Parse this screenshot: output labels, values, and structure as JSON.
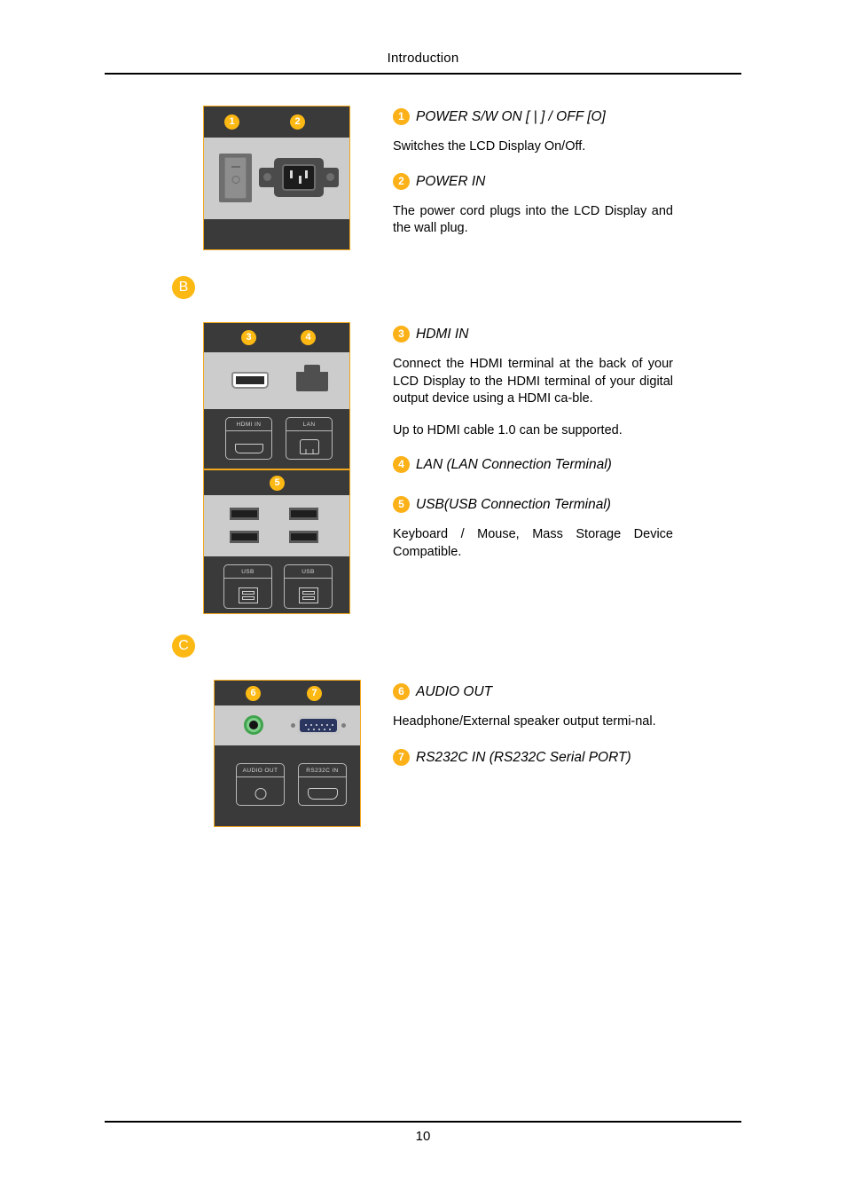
{
  "header": {
    "title": "Introduction"
  },
  "footer": {
    "page_number": "10"
  },
  "colors": {
    "badge_orange": "#fbb117",
    "panel_border_orange": "#f0a81e",
    "panel_dark": "#3a3a3a",
    "panel_light": "#cccccc",
    "audio_jack_green": "#3fa34d"
  },
  "sections": {
    "b_letter": "B",
    "c_letter": "C"
  },
  "items": [
    {
      "number": "1",
      "heading": "POWER S/W ON [ | ] / OFF [O]",
      "body": "Switches the LCD Display On/Off."
    },
    {
      "number": "2",
      "heading": "POWER IN",
      "body": "The power cord plugs into the LCD Display and the wall plug."
    },
    {
      "number": "3",
      "heading": "HDMI IN",
      "body": "Connect the HDMI terminal at the back of your LCD Display to the HDMI terminal of your digital output device using a HDMI ca-ble.",
      "body2": "Up to HDMI cable 1.0 can be supported."
    },
    {
      "number": "4",
      "heading": "LAN (LAN Connection Terminal)"
    },
    {
      "number": "5",
      "heading": "USB(USB Connection Terminal)",
      "body": "Keyboard / Mouse, Mass Storage Device Compatible."
    },
    {
      "number": "6",
      "heading": "AUDIO OUT",
      "body": "Headphone/External speaker output termi-nal."
    },
    {
      "number": "7",
      "heading": "RS232C IN (RS232C Serial PORT)"
    }
  ],
  "diagrams": {
    "power": {
      "callouts": [
        "1",
        "2"
      ]
    },
    "hdmi_lan": {
      "callouts": [
        "3",
        "4"
      ],
      "port_labels": [
        "HDMI IN",
        "LAN"
      ]
    },
    "usb": {
      "callouts": [
        "5"
      ],
      "port_labels": [
        "USB",
        "USB"
      ]
    },
    "audio_serial": {
      "callouts": [
        "6",
        "7"
      ],
      "port_labels": [
        "AUDIO OUT",
        "RS232C IN"
      ]
    }
  }
}
